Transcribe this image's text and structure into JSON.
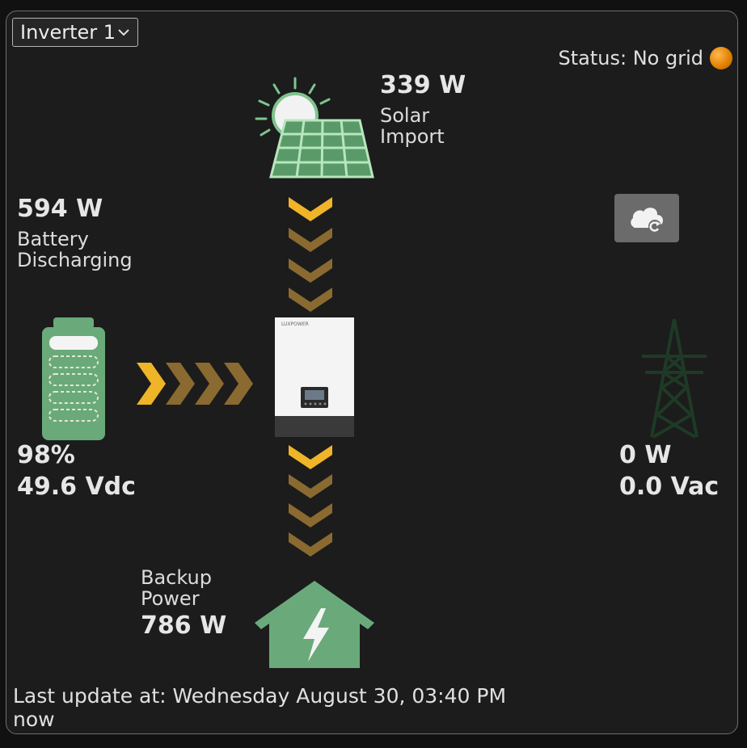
{
  "inverter_select": {
    "value": "Inverter 1"
  },
  "status": {
    "label": "Status: No grid",
    "color": "#f08c00"
  },
  "solar": {
    "power": "339 W",
    "label_line1": "Solar",
    "label_line2": "Import",
    "icon": "solar-panel-icon"
  },
  "battery": {
    "power": "594 W",
    "label_line1": "Battery",
    "label_line2": "Discharging",
    "soc": "98%",
    "voltage": "49.6 Vdc",
    "icon": "battery-icon"
  },
  "grid": {
    "power": "0 W",
    "voltage": "0.0 Vac",
    "icon": "grid-tower-icon"
  },
  "backup": {
    "label_line1": "Backup",
    "label_line2": "Power",
    "power": "786 W",
    "icon": "house-icon"
  },
  "inverter": {
    "brand": "LUXPOWER",
    "icon": "inverter-icon"
  },
  "cloud_button": {
    "icon": "cloud-refresh-icon"
  },
  "footer": {
    "last_update": "Last update at: Wednesday August 30, 03:40 PM",
    "relative": "now"
  },
  "colors": {
    "accent_green": "#6aaa7a",
    "flow_active": "#f0b429",
    "flow_dim": "#8a6a30"
  }
}
